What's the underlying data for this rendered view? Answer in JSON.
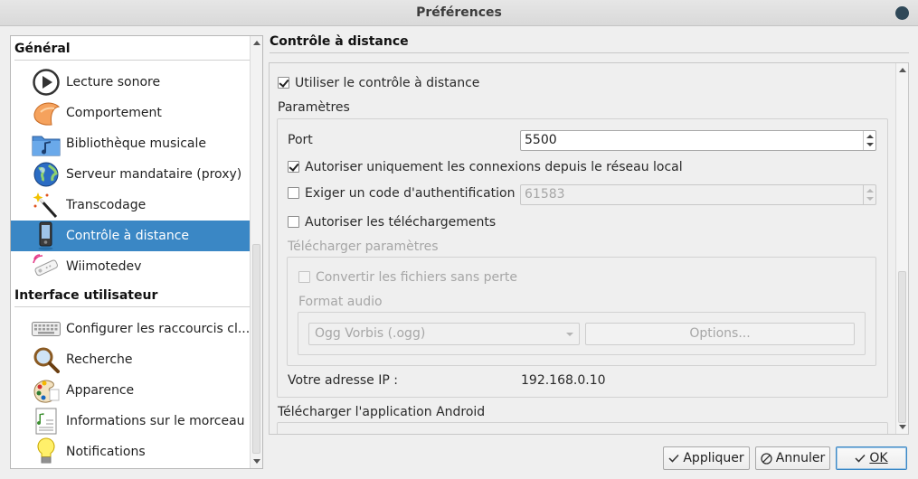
{
  "window": {
    "title": "Préférences"
  },
  "sidebar": {
    "groups": [
      {
        "label": "Général"
      },
      {
        "label": "Interface utilisateur"
      }
    ],
    "items": [
      {
        "label": "Lecture sonore",
        "icon": "play-icon"
      },
      {
        "label": "Comportement",
        "icon": "behavior-icon"
      },
      {
        "label": "Bibliothèque musicale",
        "icon": "music-folder-icon"
      },
      {
        "label": "Serveur mandataire (proxy)",
        "icon": "globe-icon"
      },
      {
        "label": "Transcodage",
        "icon": "magic-wand-icon"
      },
      {
        "label": "Contrôle à distance",
        "icon": "remote-phone-icon",
        "selected": true
      },
      {
        "label": "Wiimotedev",
        "icon": "wiimote-icon"
      },
      {
        "label": "Configurer les raccourcis cl...",
        "icon": "keyboard-icon"
      },
      {
        "label": "Recherche",
        "icon": "search-icon"
      },
      {
        "label": "Apparence",
        "icon": "palette-icon"
      },
      {
        "label": "Informations sur le morceau",
        "icon": "song-info-icon"
      },
      {
        "label": "Notifications",
        "icon": "lightbulb-icon"
      }
    ]
  },
  "page": {
    "title": "Contrôle à distance",
    "use_remote_label": "Utiliser le contrôle à distance",
    "use_remote_checked": true,
    "params_label": "Paramètres",
    "port_label": "Port",
    "port_value": "5500",
    "local_only_label": "Autoriser uniquement les connexions depuis le réseau local",
    "local_only_checked": true,
    "auth_label": "Exiger un code d'authentification",
    "auth_checked": false,
    "auth_code_value": "61583",
    "downloads_label": "Autoriser les téléchargements",
    "downloads_checked": false,
    "download_params_label": "Télécharger paramètres",
    "convert_lossless_label": "Convertir les fichiers sans perte",
    "audio_format_label": "Format audio",
    "audio_format_value": "Ogg Vorbis (.ogg)",
    "options_button": "Options...",
    "ip_label": "Votre adresse IP :",
    "ip_value": "192.168.0.10",
    "android_label": "Télécharger l'application Android"
  },
  "buttons": {
    "apply": "Appliquer",
    "cancel": "Annuler",
    "ok": "OK"
  },
  "colors": {
    "selection": "#3a87c5"
  }
}
